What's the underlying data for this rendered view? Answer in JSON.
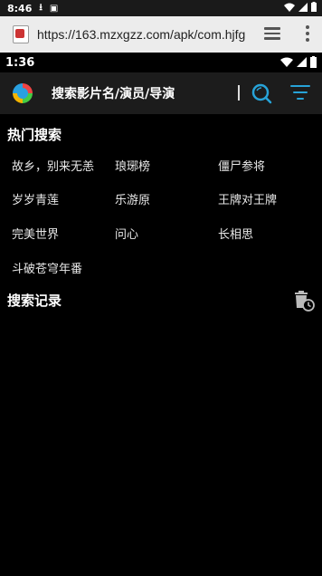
{
  "system_status": {
    "time": "8:46"
  },
  "browser": {
    "url": "https://163.mzxgzz.com/apk/com.hjfg"
  },
  "app_status": {
    "time": "1:36"
  },
  "header": {
    "search_placeholder": "搜索影片名/演员/导演"
  },
  "hot_search": {
    "title": "热门搜索",
    "items": [
      "故乡，别来无恙",
      "琅琊榜",
      "僵尸参将",
      "岁岁青莲",
      "乐游原",
      "王牌对王牌",
      "完美世界",
      "问心",
      "长相思",
      "斗破苍穹年番"
    ]
  },
  "history": {
    "title": "搜索记录"
  },
  "colors": {
    "accent": "#27a3d8",
    "background": "#000000",
    "header_bg": "#1c1c1c"
  },
  "icons": [
    "download-icon",
    "notification-icon",
    "wifi-icon",
    "signal-icon",
    "battery-icon",
    "favicon-icon",
    "tabs-icon",
    "more-vert-icon",
    "app-logo-icon",
    "search-icon",
    "filter-icon",
    "delete-history-icon"
  ]
}
